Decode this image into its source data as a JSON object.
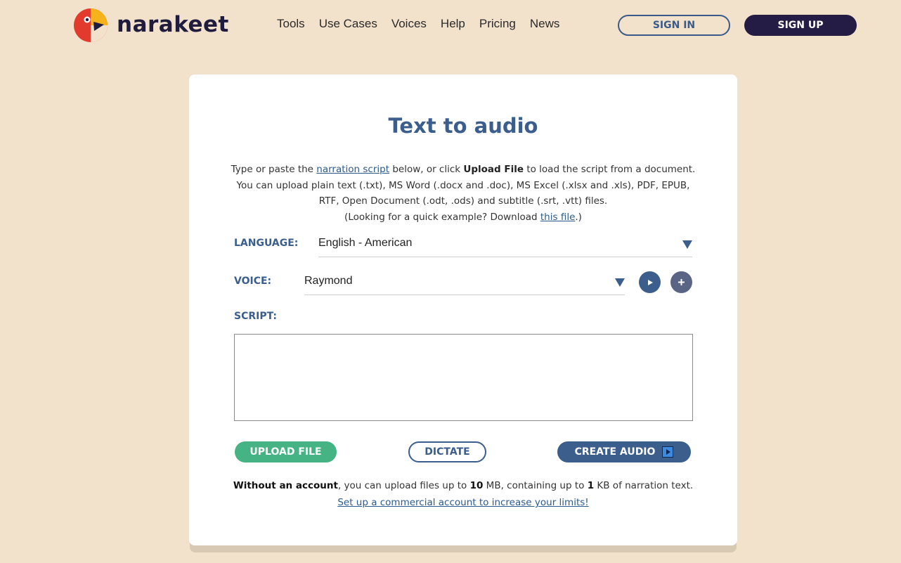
{
  "header": {
    "brand": "narakeet",
    "nav": [
      "Tools",
      "Use Cases",
      "Voices",
      "Help",
      "Pricing",
      "News"
    ],
    "sign_in": "SIGN IN",
    "sign_up": "SIGN UP"
  },
  "main": {
    "title": "Text to audio",
    "intro": {
      "p1": "Type or paste the ",
      "link_narration": "narration script",
      "p2": " below, or click ",
      "upload_bold": "Upload File",
      "p3": " to load the script from a document. You can upload plain text (.txt), MS Word (.docx and .doc), MS Excel (.xlsx and .xls), PDF, EPUB, RTF, Open Document (.odt, .ods) and subtitle (.srt, .vtt) files.",
      "p4": "(Looking for a quick example? Download ",
      "link_file": "this file",
      "p5": ".)"
    },
    "language_label": "LANGUAGE:",
    "language_value": "English - American",
    "voice_label": "VOICE:",
    "voice_value": "Raymond",
    "script_label": "SCRIPT:",
    "script_value": "",
    "buttons": {
      "upload": "UPLOAD FILE",
      "dictate": "DICTATE",
      "create": "CREATE AUDIO"
    },
    "limits": {
      "bold1": "Without an account",
      "t1": ", you can upload files up to ",
      "size": "10",
      "t2": " MB, containing up to ",
      "kb": "1",
      "t3": " KB of narration text."
    },
    "commercial_link": "Set up a commercial account to increase your limits!"
  },
  "colors": {
    "background": "#f2e2cb",
    "accent_blue": "#3b5e8c",
    "navy": "#241c45",
    "green": "#45b384"
  },
  "icons": {
    "play": "play-icon",
    "add": "plus-icon",
    "dropdown": "chevron-down-icon"
  }
}
